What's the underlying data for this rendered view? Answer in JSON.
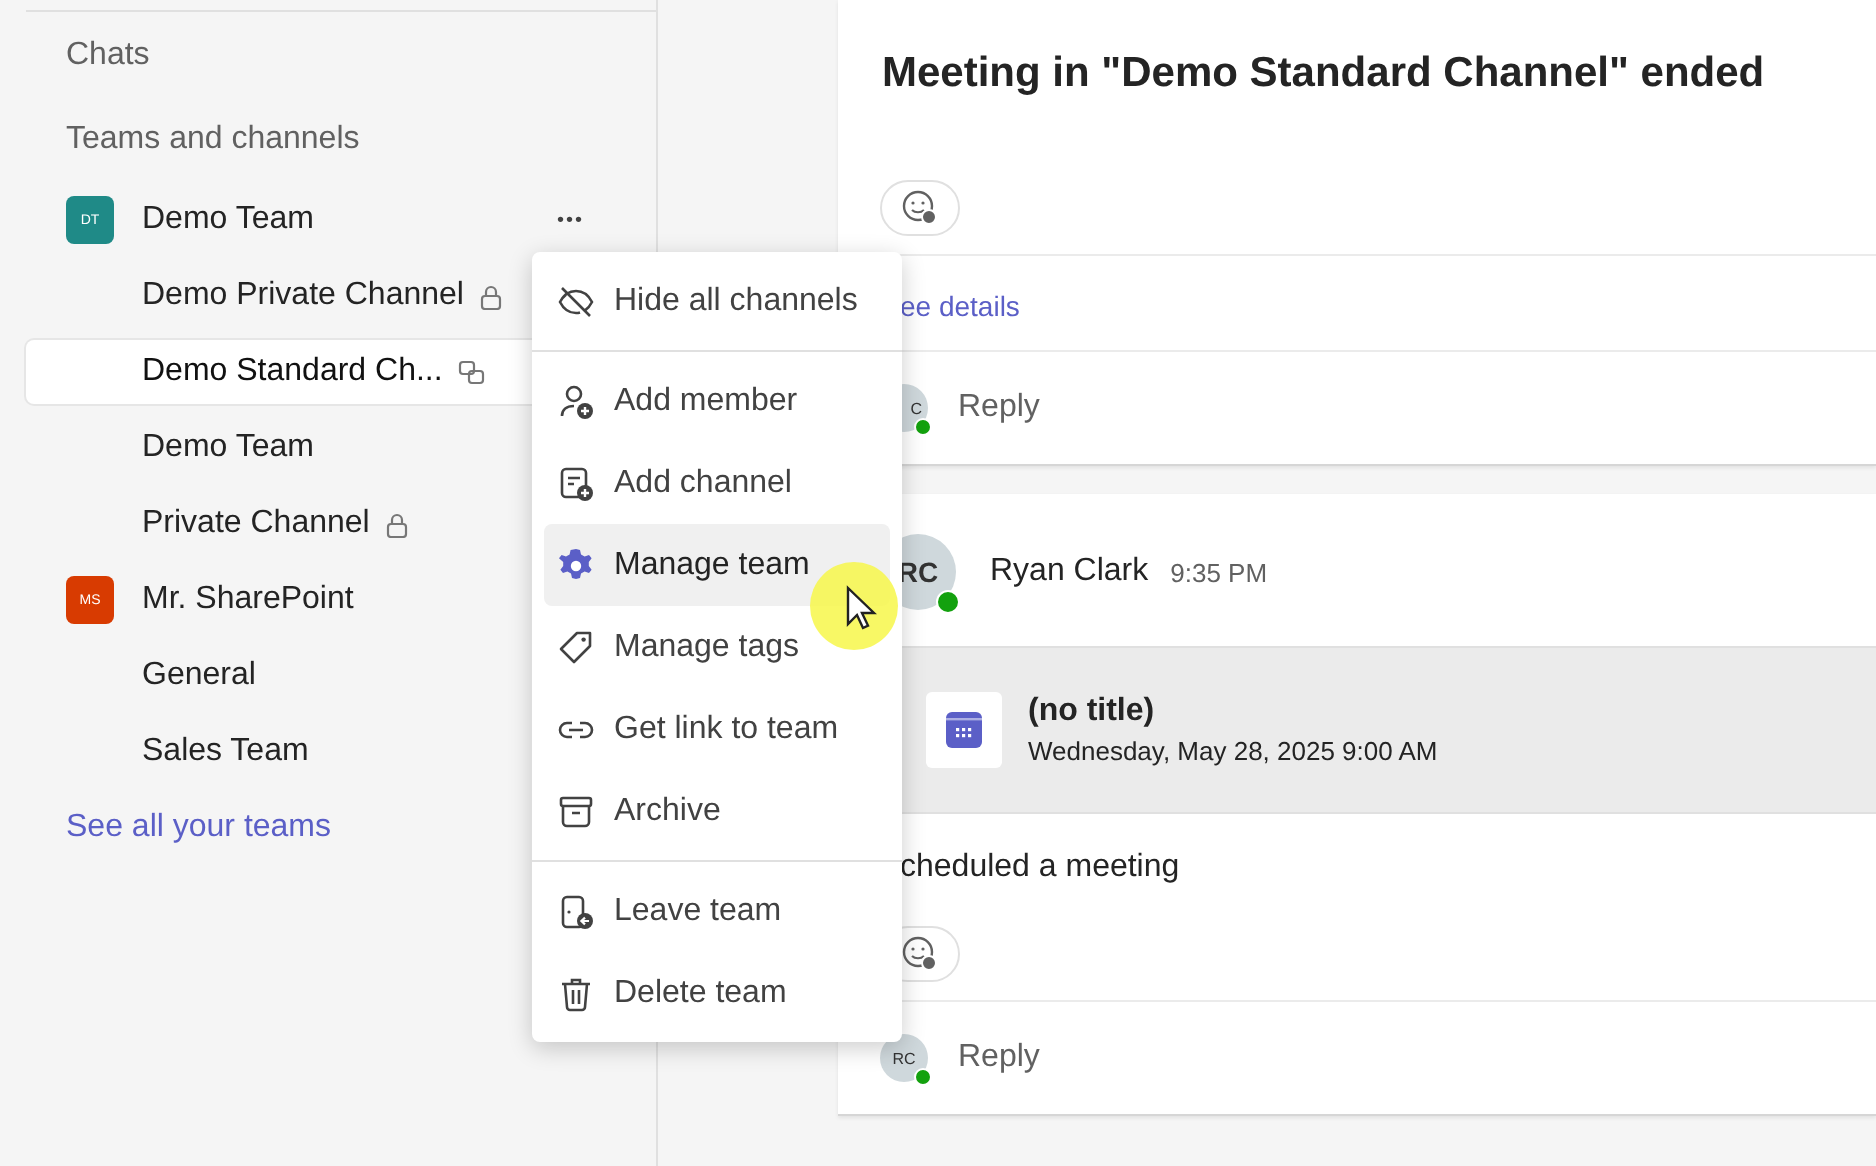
{
  "sidebar": {
    "sections": [
      "Chats",
      "Teams and channels"
    ],
    "teams": [
      {
        "initials": "DT",
        "name": "Demo Team",
        "color": "#1f8a87",
        "more": "•••",
        "channels": [
          {
            "name": "Demo Private Channel",
            "kind": "private",
            "selected": false
          },
          {
            "name": "Demo Standard Ch...",
            "kind": "shared",
            "selected": true
          },
          {
            "name": "Demo Team",
            "kind": "plain",
            "selected": false
          },
          {
            "name": "Private Channel",
            "kind": "private",
            "selected": false
          }
        ]
      },
      {
        "initials": "MS",
        "name": "Mr. SharePoint",
        "color": "#d83b01",
        "channels": [
          {
            "name": "General",
            "kind": "plain",
            "selected": false
          },
          {
            "name": "Sales Team",
            "kind": "plain",
            "selected": false
          }
        ]
      }
    ],
    "see_all": "See all your teams"
  },
  "menu": {
    "groups": [
      [
        {
          "label": "Hide all channels",
          "kind": "hide",
          "selected": false
        }
      ],
      [
        {
          "label": "Add member",
          "kind": "member",
          "selected": false
        },
        {
          "label": "Add channel",
          "kind": "channel",
          "selected": false
        },
        {
          "label": "Manage team",
          "kind": "gear",
          "selected": true
        },
        {
          "label": "Manage tags",
          "kind": "tag",
          "selected": false
        },
        {
          "label": "Get link to team",
          "kind": "link",
          "selected": false
        },
        {
          "label": "Archive",
          "kind": "archive",
          "selected": false
        }
      ],
      [
        {
          "label": "Leave team",
          "kind": "leave",
          "selected": false
        },
        {
          "label": "Delete team",
          "kind": "trash",
          "selected": false
        }
      ]
    ]
  },
  "posts": [
    {
      "title": "Meeting in \"Demo Standard Channel\" ended",
      "link": "ee details",
      "reply": {
        "initials": "C",
        "label": "Reply"
      }
    },
    {
      "author": {
        "initials": "RC",
        "name": "Ryan Clark",
        "time": "9:35 PM"
      },
      "event": {
        "title": "(no title)",
        "when": "Wednesday, May 28, 2025 9:00 AM"
      },
      "text": "cheduled a meeting",
      "reply": {
        "initials": "RC",
        "label": "Reply"
      }
    }
  ]
}
